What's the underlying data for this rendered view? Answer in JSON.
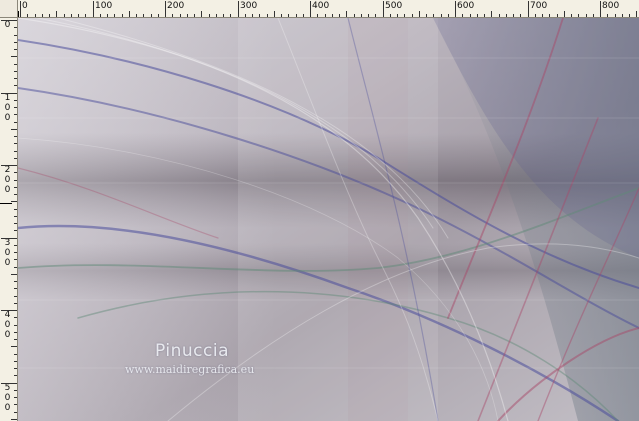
{
  "ruler_top": {
    "labels": [
      "0",
      "100",
      "200",
      "300",
      "400",
      "500",
      "600",
      "700",
      "800"
    ]
  },
  "ruler_left": {
    "labels": [
      [
        "0"
      ],
      [
        "1",
        "0",
        "0"
      ],
      [
        "2",
        "0",
        "0"
      ],
      [
        "3",
        "0",
        "0"
      ],
      [
        "4",
        "0",
        "0"
      ],
      [
        "5",
        "0",
        "0"
      ]
    ]
  },
  "watermark": {
    "name": "Pinuccia",
    "url": "www.maidiregrafica.eu"
  },
  "colors": {
    "ruler_bg": "#f3f0e4",
    "ruler_tick": "#333333",
    "canvas_base": "#b8b3bb",
    "curve_blue": "#4a4c9a",
    "curve_red": "#a84a6a",
    "curve_green": "#5f8a78"
  }
}
